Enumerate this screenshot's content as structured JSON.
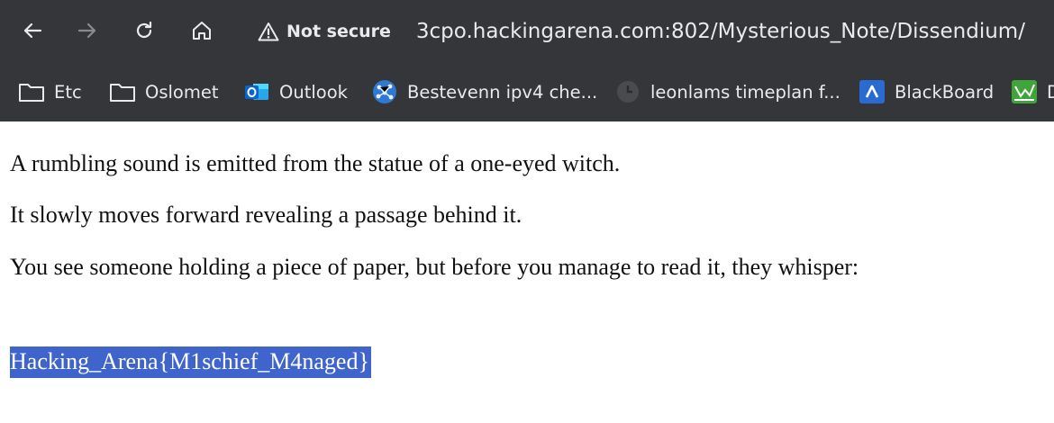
{
  "browser": {
    "security_label": "Not secure",
    "url": "3cpo.hackingarena.com:802/Mysterious_Note/Dissendium/"
  },
  "bookmarks": [
    {
      "label": "Etc",
      "icon": "folder-icon"
    },
    {
      "label": "Oslomet",
      "icon": "folder-icon"
    },
    {
      "label": "Outlook",
      "icon": "outlook-icon"
    },
    {
      "label": "Bestevenn ipv4 che...",
      "icon": "network-icon"
    },
    {
      "label": "leonlams timeplan f...",
      "icon": "clock-icon"
    },
    {
      "label": "BlackBoard",
      "icon": "blackboard-icon"
    },
    {
      "label": "D",
      "icon": "chart-icon"
    }
  ],
  "page": {
    "line1": "A rumbling sound is emitted from the statue of a one-eyed witch.",
    "line2": "It slowly moves forward revealing a passage behind it.",
    "line3": "You see someone holding a piece of paper, but before you manage to read it, they whisper:",
    "flag": "Hacking_Arena{M1schief_M4naged}"
  },
  "colors": {
    "chrome_bg": "#35363a",
    "selection_bg": "#3f65cc"
  }
}
